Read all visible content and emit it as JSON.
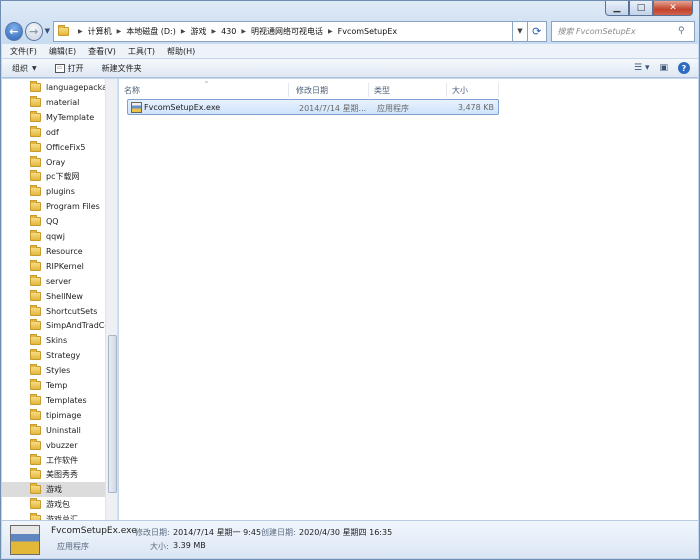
{
  "address": {
    "crumbs": [
      "计算机",
      "本地磁盘 (D:)",
      "游戏",
      "430",
      "明视通网络可视电话",
      "FvcomSetupEx"
    ]
  },
  "search": {
    "placeholder": "搜索 FvcomSetupEx"
  },
  "menu": [
    "文件(F)",
    "编辑(E)",
    "查看(V)",
    "工具(T)",
    "帮助(H)"
  ],
  "toolbar": {
    "organize": "组织",
    "open": "打开",
    "new_folder": "新建文件夹"
  },
  "nav_tree": [
    "languagepacka",
    "material",
    "MyTemplate",
    "odf",
    "OfficeFix5",
    "Oray",
    "pc下载网",
    "plugins",
    "Program Files",
    "QQ",
    "qqwj",
    "Resource",
    "RIPKernel",
    "server",
    "ShellNew",
    "ShortcutSets",
    "SimpAndTradCo",
    "Skins",
    "Strategy",
    "Styles",
    "Temp",
    "Templates",
    "tipimage",
    "Uninstall",
    "vbuzzer",
    "工作软件",
    "美图秀秀",
    "游戏",
    "游戏包",
    "游戏总汇"
  ],
  "nav_selected": "游戏",
  "columns": {
    "name": "名称",
    "modified": "修改日期",
    "type": "类型",
    "size": "大小"
  },
  "files": [
    {
      "name": "FvcomSetupEx.exe",
      "modified": "2014/7/14 星期...",
      "type": "应用程序",
      "size": "3,478 KB"
    }
  ],
  "details": {
    "filename": "FvcomSetupEx.exe",
    "modified_label": "修改日期:",
    "modified_value": "2014/7/14 星期一 9:45",
    "created_label": "创建日期:",
    "created_value": "2020/4/30 星期四 16:35",
    "type": "应用程序",
    "size_label": "大小:",
    "size_value": "3.39 MB"
  }
}
